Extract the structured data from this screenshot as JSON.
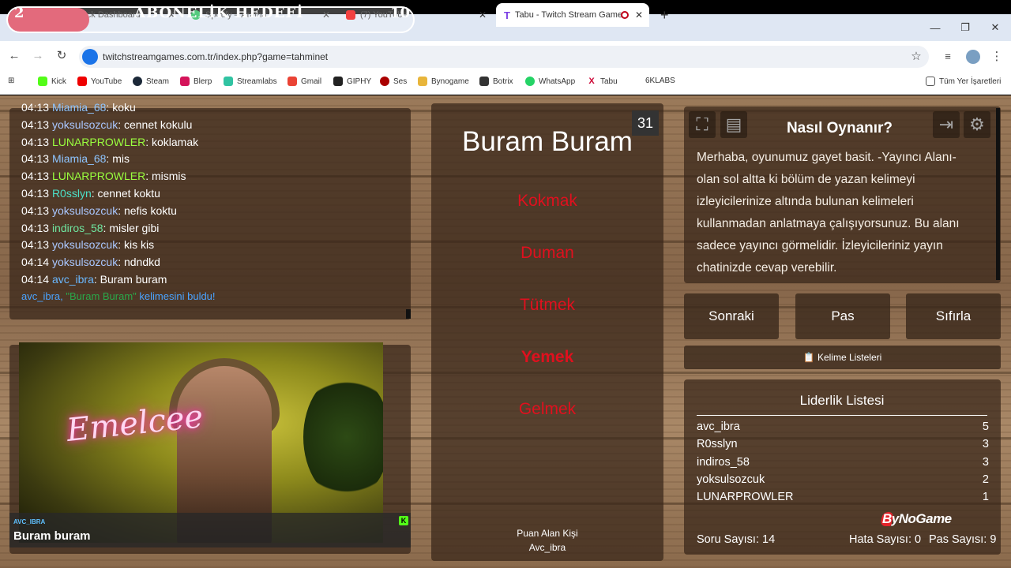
{
  "overlay": {
    "goal_title": "ABONELİK HEDEFİ",
    "goal_current": "2",
    "goal_target": "10",
    "progress_fraction": 0.2
  },
  "browser": {
    "tabs": [
      {
        "label": "Kick Dashboard"
      },
      {
        "label": "Spotify – Arama"
      },
      {
        "label": "(7) YouTube"
      },
      {
        "label": "Tabu - Twitch Stream Game"
      }
    ],
    "new_tab": "+",
    "url": "twitchstreamgames.com.tr/index.php?game=tahminet",
    "bookmarks": [
      "Kick",
      "YouTube",
      "Steam",
      "Blerp",
      "Streamlabs",
      "Gmail",
      "GIPHY",
      "Ses",
      "Bynogame",
      "Botrix",
      "WhatsApp",
      "Tabu",
      "6KLABS"
    ],
    "all_bookmarks": "Tüm Yer İşaretleri"
  },
  "chat": {
    "messages": [
      {
        "time": "04:13",
        "user": "Miamia_68",
        "text": "koku",
        "color": "#8ec5ff"
      },
      {
        "time": "04:13",
        "user": "yoksulsozcuk",
        "text": "cennet kokulu",
        "color": "#a9c7ff"
      },
      {
        "time": "04:13",
        "user": "LUNARPROWLER",
        "text": "koklamak",
        "color": "#9aff3f"
      },
      {
        "time": "04:13",
        "user": "Miamia_68",
        "text": "mis",
        "color": "#8ec5ff"
      },
      {
        "time": "04:13",
        "user": "LUNARPROWLER",
        "text": "mismis",
        "color": "#9aff3f"
      },
      {
        "time": "04:13",
        "user": "R0sslyn",
        "text": "cennet koktu",
        "color": "#4be0c8"
      },
      {
        "time": "04:13",
        "user": "yoksulsozcuk",
        "text": "nefis koktu",
        "color": "#a9c7ff"
      },
      {
        "time": "04:13",
        "user": "indiros_58",
        "text": "misler gibi",
        "color": "#6fe6a0"
      },
      {
        "time": "04:13",
        "user": "yoksulsozcuk",
        "text": "kis kis",
        "color": "#a9c7ff"
      },
      {
        "time": "04:14",
        "user": "yoksulsozcuk",
        "text": "ndndkd",
        "color": "#a9c7ff"
      },
      {
        "time": "04:14",
        "user": "avc_ibra",
        "text": "Buram buram",
        "color": "#6ab8ff"
      }
    ],
    "found_user": "avc_ibra",
    "found_word": "\"Buram Buram\"",
    "found_suffix": "kelimesini buldu!"
  },
  "cam": {
    "neon_text": "Emelcee",
    "last_user": "AVC_IBRA",
    "last_message": "Buram buram",
    "badge": "K"
  },
  "card": {
    "counter": "31",
    "word": "Buram Buram",
    "taboo": [
      "Kokmak",
      "Duman",
      "Tütmek",
      "Yemek",
      "Gelmek"
    ],
    "scorer_label": "Puan Alan Kişi",
    "scorer_name": "Avc_ibra"
  },
  "howto": {
    "title": "Nasıl Oynanır?",
    "text": "Merhaba, oyunumuz gayet basit. -Yayıncı Alanı- olan sol altta ki bölüm de yazan kelimeyi izleyicilerinize altında bulunan kelimeleri kullanmadan anlatmaya çalışıyorsunuz. Bu alanı sadece yayıncı görmelidir. İzleyicileriniz yayın chatinizde cevap verebilir."
  },
  "buttons": {
    "next": "Sonraki",
    "pass": "Pas",
    "reset": "Sıfırla",
    "word_lists": "📋 Kelime Listeleri"
  },
  "leaderboard": {
    "title": "Liderlik Listesi",
    "rows": [
      {
        "name": "avc_ibra",
        "score": "5"
      },
      {
        "name": "R0sslyn",
        "score": "3"
      },
      {
        "name": "indiros_58",
        "score": "3"
      },
      {
        "name": "yoksulsozcuk",
        "score": "2"
      },
      {
        "name": "LUNARPROWLER",
        "score": "1"
      }
    ],
    "brand": "ByNoGame",
    "questions": "Soru Sayısı: 14",
    "errors": "Hata Sayısı: 0",
    "passes": "Pas Sayısı: 9"
  }
}
